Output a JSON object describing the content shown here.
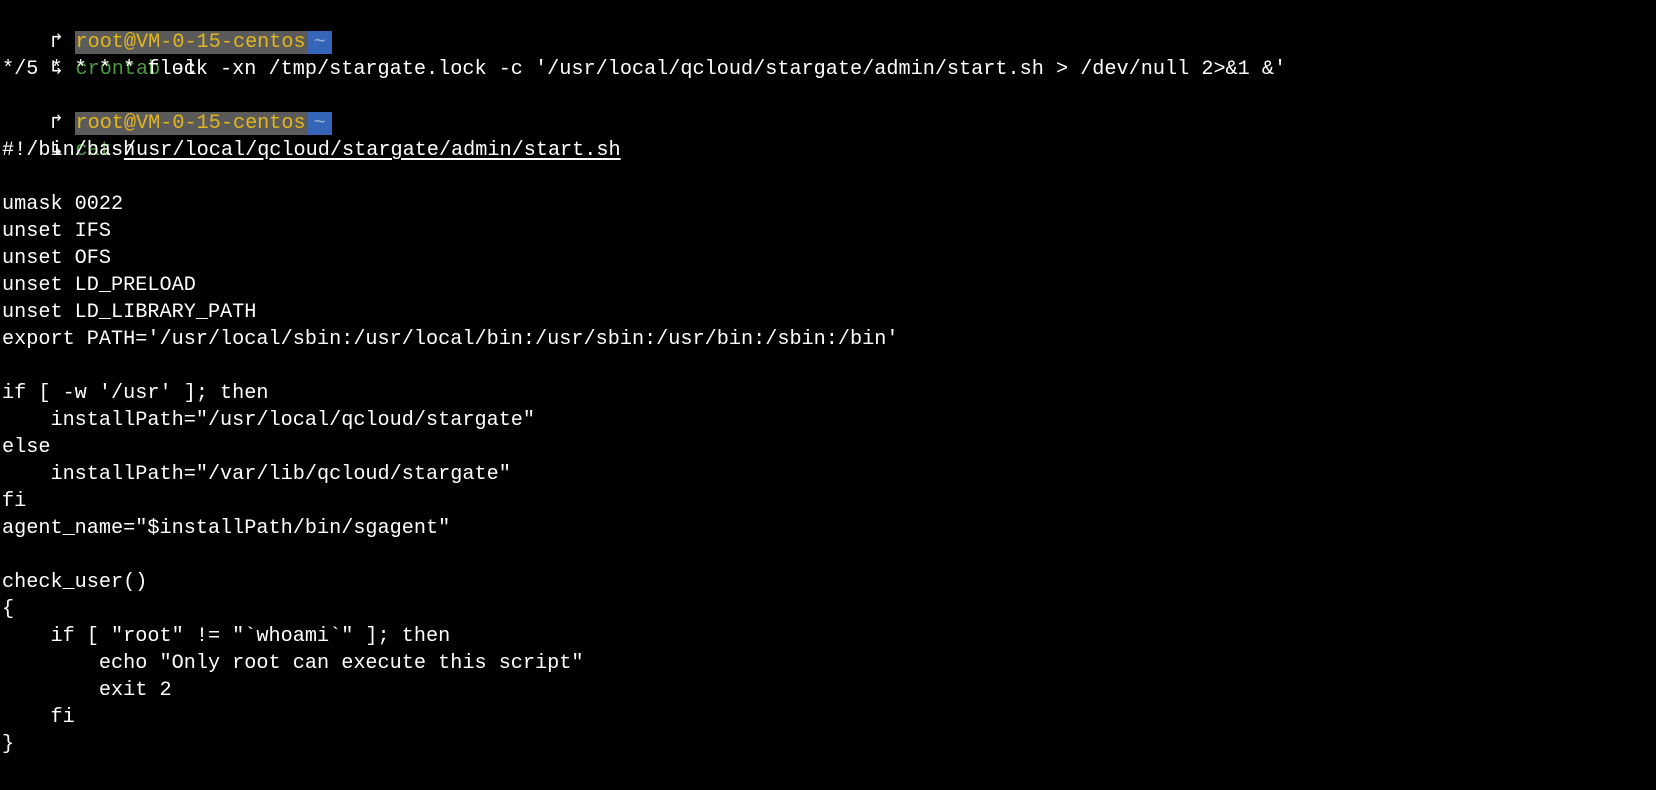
{
  "prompt": {
    "user_host": "root@VM-0-15-centos",
    "directory": "~",
    "corner_top": "↱",
    "corner_bottom": "↳",
    "separator_glyph": "",
    "end_glyph": ""
  },
  "commands": [
    {
      "name": "crontab",
      "args": "-l"
    },
    {
      "name": "cat",
      "args": "/usr/local/qcloud/stargate/admin/start.sh"
    }
  ],
  "crontab_output": "*/5 * * * * flock -xn /tmp/stargate.lock -c '/usr/local/qcloud/stargate/admin/start.sh > /dev/null 2>&1 &'",
  "script_lines": [
    "#!/bin/bash",
    "",
    "umask 0022",
    "unset IFS",
    "unset OFS",
    "unset LD_PRELOAD",
    "unset LD_LIBRARY_PATH",
    "export PATH='/usr/local/sbin:/usr/local/bin:/usr/sbin:/usr/bin:/sbin:/bin'",
    "",
    "if [ -w '/usr' ]; then",
    "    installPath=\"/usr/local/qcloud/stargate\"",
    "else",
    "    installPath=\"/var/lib/qcloud/stargate\"",
    "fi",
    "agent_name=\"$installPath/bin/sgagent\"",
    "",
    "check_user()",
    "{",
    "    if [ \"root\" != \"`whoami`\" ]; then",
    "        echo \"Only root can execute this script\"",
    "        exit 2",
    "    fi",
    "}"
  ],
  "colors": {
    "background": "#000000",
    "host_fg": "#e3b61c",
    "host_bg": "#5b5b5b",
    "dir_bg": "#3465b8",
    "command": "#4e9a3f",
    "text": "#ffffff"
  }
}
